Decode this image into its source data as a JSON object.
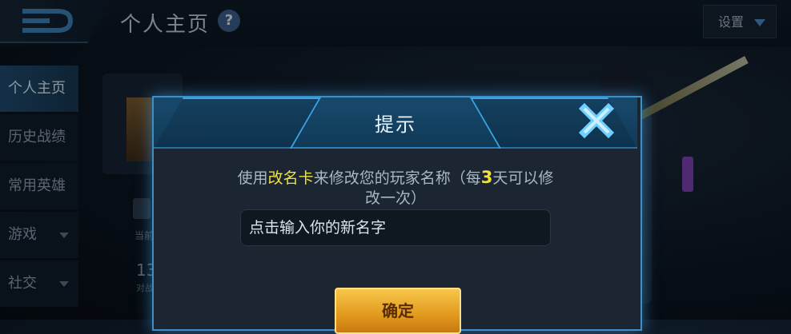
{
  "header": {
    "title": "个人主页",
    "help_icon": "?",
    "settings_label": "设置"
  },
  "sidebar": {
    "items": [
      {
        "label": "个人主页",
        "active": true
      },
      {
        "label": "历史战绩"
      },
      {
        "label": "常用英雄"
      },
      {
        "label": "游戏",
        "has_dropdown": true
      },
      {
        "label": "社交",
        "has_dropdown": true
      }
    ]
  },
  "background": {
    "label_partial": "当前",
    "number_partial": "13",
    "sub_partial": "对战"
  },
  "dialog": {
    "title": "提示",
    "message_pre": "使用",
    "message_card": "改名卡",
    "message_mid": "来修改您的玩家名称（每",
    "message_days": "3",
    "message_post": "天可以修改一次）",
    "input_placeholder": "点击输入你的新名字",
    "confirm_label": "确定"
  },
  "colors": {
    "highlight": "#f1e23a",
    "accent_blue": "#3f8ec4",
    "confirm_gold": "#e29a1e"
  }
}
